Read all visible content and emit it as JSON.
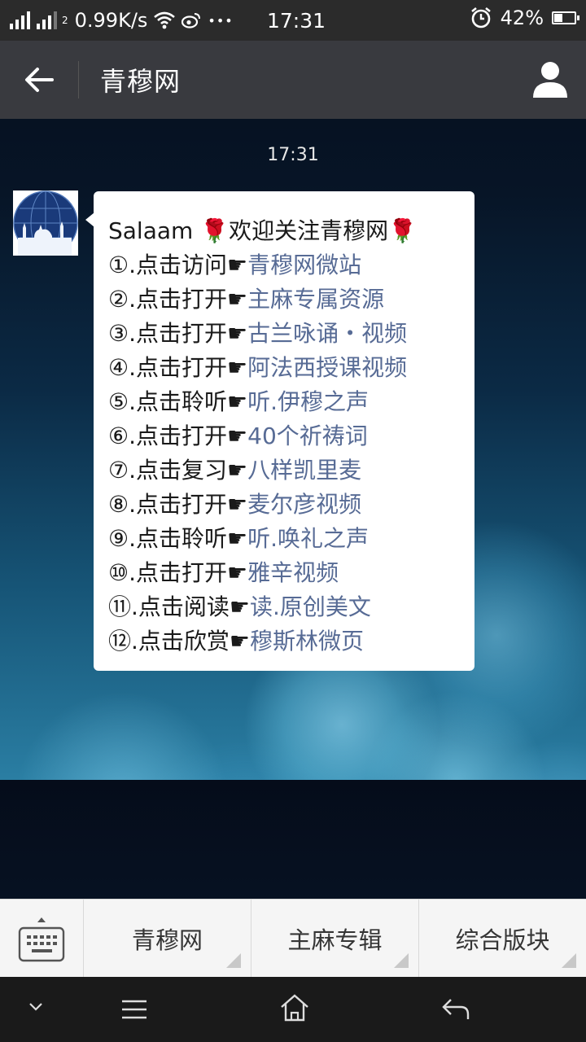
{
  "status_bar": {
    "sim2_label": "2",
    "net_speed": "0.99K/s",
    "time": "17:31",
    "battery": "42%",
    "battery_level": 0.42,
    "more_icon": "•••"
  },
  "header": {
    "title": "青穆网"
  },
  "chat": {
    "timestamp": "17:31",
    "message": {
      "greeting": "Salaam ",
      "welcome": "欢迎关注青穆网",
      "rose": "🌹",
      "hand": "☛",
      "items": [
        {
          "prefix": "①.点击访问",
          "link": "青穆网微站"
        },
        {
          "prefix": "②.点击打开",
          "link": "主麻专属资源"
        },
        {
          "prefix": "③.点击打开",
          "link": "古兰咏诵・视频"
        },
        {
          "prefix": "④.点击打开",
          "link": "阿法西授课视频"
        },
        {
          "prefix": "⑤.点击聆听",
          "link": "听.伊穆之声"
        },
        {
          "prefix": "⑥.点击打开",
          "link": "40个祈祷词"
        },
        {
          "prefix": "⑦.点击复习",
          "link": "八样凯里麦"
        },
        {
          "prefix": "⑧.点击打开",
          "link": "麦尔彦视频"
        },
        {
          "prefix": "⑨.点击聆听",
          "link": "听.唤礼之声"
        },
        {
          "prefix": "⑩.点击打开",
          "link": "雅辛视频"
        },
        {
          "prefix": "⑪.点击阅读",
          "link": "读.原创美文"
        },
        {
          "prefix": "⑫.点击欣赏",
          "link": "穆斯林微页"
        }
      ]
    }
  },
  "menu": {
    "items": [
      {
        "label": "青穆网"
      },
      {
        "label": "主麻专辑"
      },
      {
        "label": "综合版块"
      }
    ]
  },
  "colors": {
    "link": "#576b95",
    "title_bar": "#393a3f",
    "rose": "#d3202f"
  },
  "icons": [
    "signal-icon",
    "wifi-icon",
    "weibo-icon",
    "alarm-icon",
    "battery-icon",
    "back-arrow-icon",
    "profile-icon",
    "keyboard-icon",
    "nav-down-icon",
    "nav-menu-icon",
    "nav-home-icon",
    "nav-back-icon"
  ]
}
